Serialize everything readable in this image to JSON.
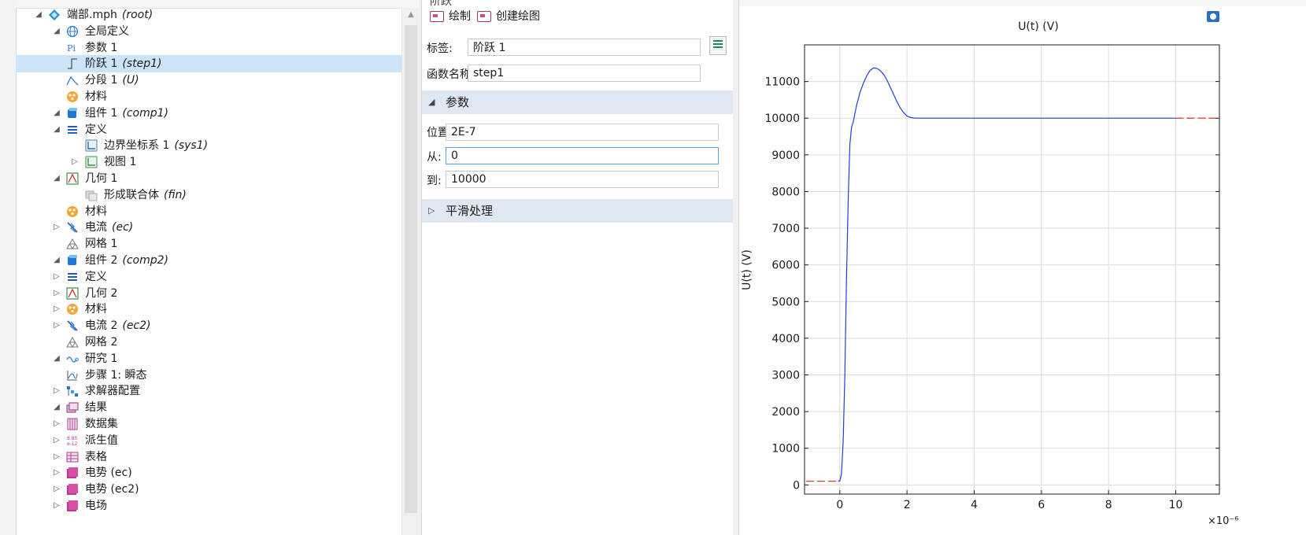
{
  "tree": {
    "items": [
      {
        "label": "端部.mph",
        "tag": "(root)",
        "icon": "model-icon",
        "level": 0,
        "arrow": "expanded"
      },
      {
        "label": "全局定义",
        "tag": "",
        "icon": "globe-icon",
        "level": 1,
        "arrow": "expanded"
      },
      {
        "label": "参数 1",
        "tag": "",
        "icon": "parameters-icon",
        "level": 2,
        "arrow": "none"
      },
      {
        "label": "阶跃 1",
        "tag": "(step1)",
        "icon": "step-function-icon",
        "level": 2,
        "arrow": "none",
        "selected": true
      },
      {
        "label": "分段 1",
        "tag": "(U)",
        "icon": "piecewise-icon",
        "level": 2,
        "arrow": "none"
      },
      {
        "label": "材料",
        "tag": "",
        "icon": "materials-icon",
        "level": 2,
        "arrow": "none"
      },
      {
        "label": "组件 1",
        "tag": "(comp1)",
        "icon": "component-icon",
        "level": 1,
        "arrow": "expanded"
      },
      {
        "label": "定义",
        "tag": "",
        "icon": "definitions-icon",
        "level": 2,
        "arrow": "expanded"
      },
      {
        "label": "边界坐标系 1",
        "tag": "(sys1)",
        "icon": "coordinate-system-icon",
        "level": 3,
        "arrow": "none"
      },
      {
        "label": "视图 1",
        "tag": "",
        "icon": "view-icon",
        "level": 3,
        "arrow": "collapsed"
      },
      {
        "label": "几何 1",
        "tag": "",
        "icon": "geometry-icon",
        "level": 2,
        "arrow": "expanded"
      },
      {
        "label": "形成联合体",
        "tag": "(fin)",
        "icon": "form-union-icon",
        "level": 3,
        "arrow": "none"
      },
      {
        "label": "材料",
        "tag": "",
        "icon": "materials-icon",
        "level": 2,
        "arrow": "none"
      },
      {
        "label": "电流",
        "tag": "(ec)",
        "icon": "electric-currents-icon",
        "level": 2,
        "arrow": "collapsed"
      },
      {
        "label": "网格 1",
        "tag": "",
        "icon": "mesh-icon",
        "level": 2,
        "arrow": "none"
      },
      {
        "label": "组件 2",
        "tag": "(comp2)",
        "icon": "component-icon",
        "level": 1,
        "arrow": "expanded"
      },
      {
        "label": "定义",
        "tag": "",
        "icon": "definitions-icon",
        "level": 2,
        "arrow": "collapsed"
      },
      {
        "label": "几何 2",
        "tag": "",
        "icon": "geometry-icon",
        "level": 2,
        "arrow": "collapsed"
      },
      {
        "label": "材料",
        "tag": "",
        "icon": "materials-icon",
        "level": 2,
        "arrow": "collapsed"
      },
      {
        "label": "电流 2",
        "tag": "(ec2)",
        "icon": "electric-currents-icon",
        "level": 2,
        "arrow": "collapsed"
      },
      {
        "label": "网格 2",
        "tag": "",
        "icon": "mesh-icon",
        "level": 2,
        "arrow": "none"
      },
      {
        "label": "研究 1",
        "tag": "",
        "icon": "study-icon",
        "level": 1,
        "arrow": "expanded"
      },
      {
        "label": "步骤 1: 瞬态",
        "tag": "",
        "icon": "time-dependent-step-icon",
        "level": 2,
        "arrow": "none"
      },
      {
        "label": "求解器配置",
        "tag": "",
        "icon": "solver-configurations-icon",
        "level": 2,
        "arrow": "collapsed"
      },
      {
        "label": "结果",
        "tag": "",
        "icon": "results-icon",
        "level": 1,
        "arrow": "expanded"
      },
      {
        "label": "数据集",
        "tag": "",
        "icon": "datasets-icon",
        "level": 2,
        "arrow": "collapsed"
      },
      {
        "label": "派生值",
        "tag": "",
        "icon": "derived-values-icon",
        "level": 2,
        "arrow": "collapsed"
      },
      {
        "label": "表格",
        "tag": "",
        "icon": "tables-icon",
        "level": 2,
        "arrow": "collapsed"
      },
      {
        "label": "电势 (ec)",
        "tag": "",
        "icon": "plot-group-icon",
        "level": 2,
        "arrow": "collapsed"
      },
      {
        "label": "电势 (ec2)",
        "tag": "",
        "icon": "plot-group-icon",
        "level": 2,
        "arrow": "collapsed"
      },
      {
        "label": "电场",
        "tag": "",
        "icon": "plot-group-icon",
        "level": 2,
        "arrow": "collapsed"
      }
    ]
  },
  "settings": {
    "title": "阶跃",
    "toolbar": {
      "plot_label": "绘制",
      "create_plot_label": "创建绘图"
    },
    "label_field": {
      "label": "标签:",
      "value": "阶跃 1"
    },
    "function_name_field": {
      "label": "函数名称:",
      "value": "step1"
    },
    "parameters_section": {
      "label": "参数"
    },
    "location_field": {
      "label": "位置:",
      "value": "2E-7"
    },
    "from_field": {
      "label": "从:",
      "value": "0"
    },
    "to_field": {
      "label": "到:",
      "value": "10000"
    },
    "smoothing_section": {
      "label": "平滑处理"
    }
  },
  "colors": {
    "curve": "#1f3fd6",
    "extension": "#d42020",
    "section_bg": "#dfe8f2",
    "selection": "#cce4f7"
  },
  "chart_data": {
    "type": "line",
    "title": "U(t) (V)",
    "ylabel": "U(t) (V)",
    "xlabel": "",
    "x_multiplier": "×10⁻⁶",
    "xlim": [
      -1.05,
      11.3
    ],
    "ylim": [
      -250,
      12000
    ],
    "xticks": [
      0,
      2,
      4,
      6,
      8,
      10
    ],
    "yticks": [
      0,
      1000,
      2000,
      3000,
      4000,
      5000,
      6000,
      7000,
      8000,
      9000,
      10000,
      11000
    ],
    "grid": true,
    "series": [
      {
        "values_x": [
          -0.05,
          0.0,
          0.05,
          0.1,
          0.15,
          0.2,
          0.25,
          0.3,
          0.35,
          0.4,
          0.5,
          0.6,
          0.7,
          0.8,
          0.9,
          1.0,
          1.1,
          1.2,
          1.3,
          1.4,
          1.5,
          1.6,
          1.7,
          1.8,
          1.9,
          2.0,
          2.1,
          2.2,
          2.3,
          2.4,
          3.0,
          4.0,
          5.0,
          6.0,
          7.0,
          8.0,
          9.0,
          10.0
        ],
        "values_y": [
          100,
          110,
          300,
          1200,
          3000,
          5600,
          7800,
          9300,
          9750,
          9900,
          10350,
          10700,
          10950,
          11150,
          11300,
          11370,
          11360,
          11300,
          11200,
          11050,
          10850,
          10650,
          10450,
          10280,
          10150,
          10060,
          10020,
          10005,
          10000,
          10000,
          10000,
          10000,
          10000,
          10000,
          10000,
          10000,
          10000,
          10000
        ]
      },
      {
        "values_x": [
          -1.0,
          -0.05
        ],
        "values_y": [
          100,
          100
        ]
      },
      {
        "values_x": [
          10.0,
          11.2
        ],
        "values_y": [
          10000,
          10000
        ]
      }
    ]
  }
}
